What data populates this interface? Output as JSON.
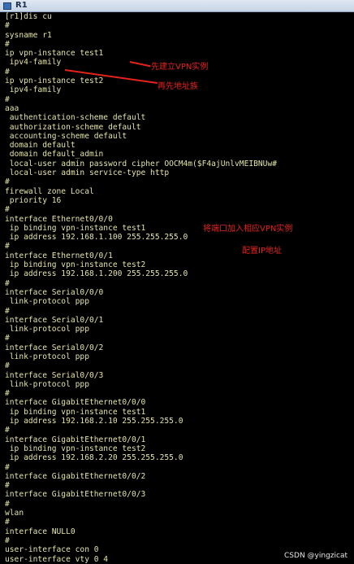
{
  "window": {
    "title": "R1"
  },
  "terminal_lines": [
    "[r1]dis cu",
    "#",
    "sysname r1",
    "#",
    "ip vpn-instance test1",
    " ipv4-family",
    "#",
    "ip vpn-instance test2",
    " ipv4-family",
    "#",
    "aaa",
    " authentication-scheme default",
    " authorization-scheme default",
    " accounting-scheme default",
    " domain default",
    " domain default_admin",
    " local-user admin password cipher OOCM4m($F4ajUnlvMEIBNUw#",
    " local-user admin service-type http",
    "#",
    "firewall zone Local",
    " priority 16",
    "#",
    "interface Ethernet0/0/0",
    " ip binding vpn-instance test1",
    " ip address 192.168.1.100 255.255.255.0",
    "#",
    "interface Ethernet0/0/1",
    " ip binding vpn-instance test2",
    " ip address 192.168.1.200 255.255.255.0",
    "#",
    "interface Serial0/0/0",
    " link-protocol ppp",
    "#",
    "interface Serial0/0/1",
    " link-protocol ppp",
    "#",
    "interface Serial0/0/2",
    " link-protocol ppp",
    "#",
    "interface Serial0/0/3",
    " link-protocol ppp",
    "#",
    "interface GigabitEthernet0/0/0",
    " ip binding vpn-instance test1",
    " ip address 192.168.2.10 255.255.255.0",
    "#",
    "interface GigabitEthernet0/0/1",
    " ip binding vpn-instance test2",
    " ip address 192.168.2.20 255.255.255.0",
    "#",
    "interface GigabitEthernet0/0/2",
    "#",
    "interface GigabitEthernet0/0/3",
    "#",
    "wlan",
    "#",
    "interface NULL0",
    "#",
    "user-interface con 0",
    "user-interface vty 0 4"
  ],
  "annotations": [
    "先建立VPN实例",
    "再先地址族",
    "将端口加入相应VPN实例",
    "配置IP地址"
  ],
  "watermark": "CSDN @yingzicat",
  "colors": {
    "terminal_bg": "#000000",
    "terminal_text": "#e4e4a6",
    "annotation": "#e5231b"
  }
}
